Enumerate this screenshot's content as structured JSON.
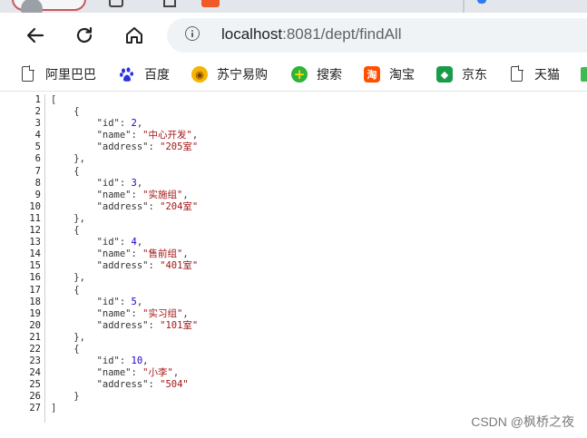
{
  "browser": {
    "address": {
      "host": "localhost",
      "rest": ":8081/dept/findAll"
    },
    "bookmarks": [
      {
        "label": "阿里巴巴",
        "icon": "document-icon"
      },
      {
        "label": "百度",
        "icon": "baidu-paw-icon"
      },
      {
        "label": "苏宁易购",
        "icon": "suning-lion-icon"
      },
      {
        "label": "搜索",
        "icon": "search-plus-icon"
      },
      {
        "label": "淘宝",
        "icon": "taobao-icon"
      },
      {
        "label": "京东",
        "icon": "jd-icon"
      },
      {
        "label": "天猫",
        "icon": "document-icon"
      }
    ]
  },
  "json_view": {
    "line_numbers": [
      "1",
      "2",
      "3",
      "4",
      "5",
      "6",
      "7",
      "8",
      "9",
      "10",
      "11",
      "12",
      "13",
      "14",
      "15",
      "16",
      "17",
      "18",
      "19",
      "20",
      "21",
      "22",
      "23",
      "24",
      "25",
      "26",
      "27"
    ],
    "items": [
      {
        "id": "2",
        "name": "中心开发",
        "address": "205室"
      },
      {
        "id": "3",
        "name": "实施组",
        "address": "204室"
      },
      {
        "id": "4",
        "name": "售前组",
        "address": "401室"
      },
      {
        "id": "5",
        "name": "实习组",
        "address": "101室"
      },
      {
        "id": "10",
        "name": "小李",
        "address": "504"
      }
    ]
  },
  "watermark": "CSDN @枫桥之夜",
  "colors": {
    "key": "#333333",
    "number": "#1c00cf",
    "string": "#a31515",
    "tab_border": "#c9575d"
  }
}
